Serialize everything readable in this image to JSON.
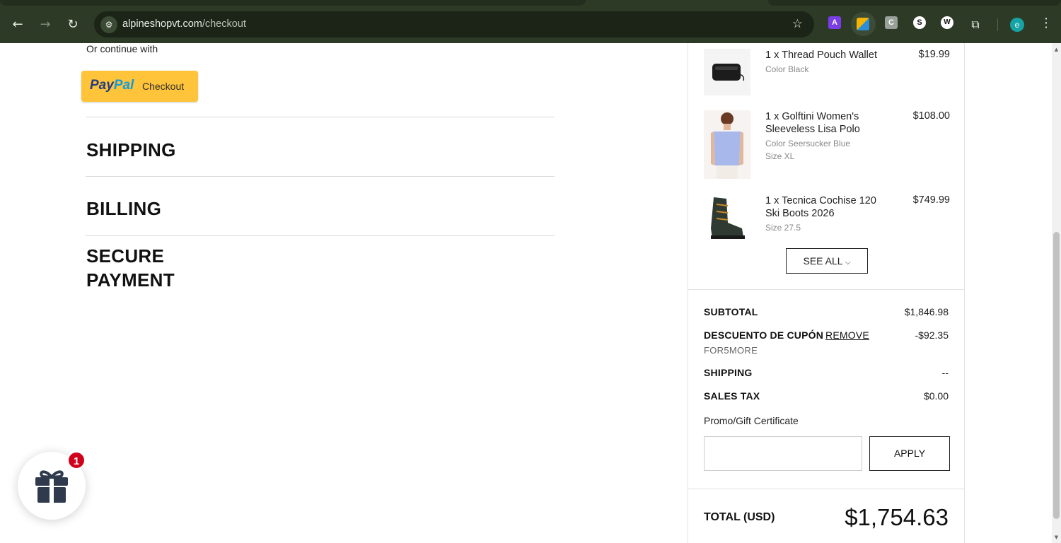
{
  "browser": {
    "url_domain": "alpineshopvt.com",
    "url_path": "/checkout",
    "profile_initial": "e",
    "extensions": [
      {
        "name": "A",
        "bg": "#7a3ee6",
        "fg": "#ffffff"
      },
      {
        "name": "",
        "bg": "#2b8ed8",
        "fg": "#ffffff"
      },
      {
        "name": "C",
        "bg": "#9aa09a",
        "fg": "#ffffff"
      },
      {
        "name": "S",
        "bg": "#ffffff",
        "fg": "#111111"
      },
      {
        "name": "W",
        "bg": "#ffffff",
        "fg": "#111111"
      }
    ]
  },
  "checkout": {
    "or_continue": "Or continue with",
    "paypal_brand_pay": "Pay",
    "paypal_brand_pal": "Pal",
    "paypal_checkout": "Checkout",
    "sections": [
      "SHIPPING",
      "BILLING",
      "SECURE",
      "PAYMENT"
    ]
  },
  "order": {
    "items": [
      {
        "name": "1 x Thread Pouch Wallet",
        "meta1": "Color Black",
        "meta2": "",
        "price": "$19.99",
        "icon": "wallet-image"
      },
      {
        "name": "1 x Golftini Women's Sleeveless Lisa Polo",
        "meta1": "Color Seersucker Blue",
        "meta2": "Size XL",
        "price": "$108.00",
        "icon": "polo-image"
      },
      {
        "name": "1 x Tecnica Cochise 120 Ski Boots 2026",
        "meta1": "Size 27.5",
        "meta2": "",
        "price": "$749.99",
        "icon": "ski-boot-image"
      }
    ],
    "see_all": "SEE ALL",
    "subtotal_label": "SUBTOTAL",
    "subtotal_value": "$1,846.98",
    "coupon_label": "DESCUENTO DE CUPÓN",
    "coupon_remove": "REMOVE",
    "coupon_value": "-$92.35",
    "coupon_code": "FOR5MORE",
    "shipping_label": "SHIPPING",
    "shipping_value": "--",
    "tax_label": "SALES TAX",
    "tax_value": "$0.00",
    "promo_label": "Promo/Gift Certificate",
    "promo_placeholder": "",
    "apply": "APPLY",
    "total_label": "TOTAL (USD)",
    "total_value": "$1,754.63"
  },
  "gift_widget": {
    "badge": "1",
    "icon": "gift-icon"
  }
}
